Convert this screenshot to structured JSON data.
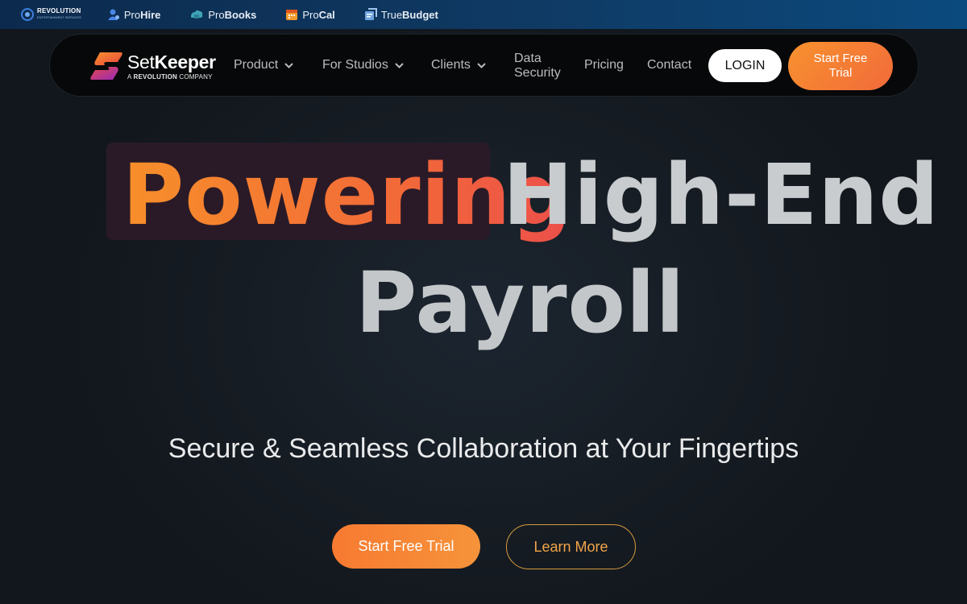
{
  "topbar": {
    "revolution": {
      "name": "REVOLUTION",
      "tagline": "ENTERTAINMENT SERVICES"
    },
    "links": [
      {
        "prefix": "Pro",
        "name": "Hire",
        "icon": "prohire-icon"
      },
      {
        "prefix": "Pro",
        "name": "Books",
        "icon": "probooks-icon"
      },
      {
        "prefix": "Pro",
        "name": "Cal",
        "icon": "procal-icon"
      },
      {
        "prefix": "True",
        "name": "Budget",
        "icon": "truebudget-icon"
      }
    ]
  },
  "nav": {
    "logo": {
      "name_a": "Set",
      "name_b": "Keeper",
      "sub_a": "A ",
      "sub_b": "REVOLUTION",
      "sub_c": " COMPANY"
    },
    "items": [
      {
        "label": "Product",
        "dropdown": true
      },
      {
        "label": "For Studios",
        "dropdown": true
      },
      {
        "label": "Clients",
        "dropdown": true
      },
      {
        "label_line1": "Data",
        "label_line2": "Security"
      },
      {
        "label": "Pricing"
      },
      {
        "label": "Contact"
      }
    ],
    "login_label": "LOGIN",
    "trial_label": "Start Free Trial"
  },
  "hero": {
    "highlight_word": "Powering",
    "title_rest_1": "High-End",
    "title_rest_2": "Payroll",
    "subtitle": "Secure & Seamless Collaboration at Your Fingertips",
    "primary_cta": "Start Free Trial",
    "secondary_cta": "Learn More"
  },
  "colors": {
    "accent_orange": "#f7922e",
    "accent_red": "#ec4f4a",
    "background": "#151b22",
    "topbar": "#0f3a64"
  }
}
